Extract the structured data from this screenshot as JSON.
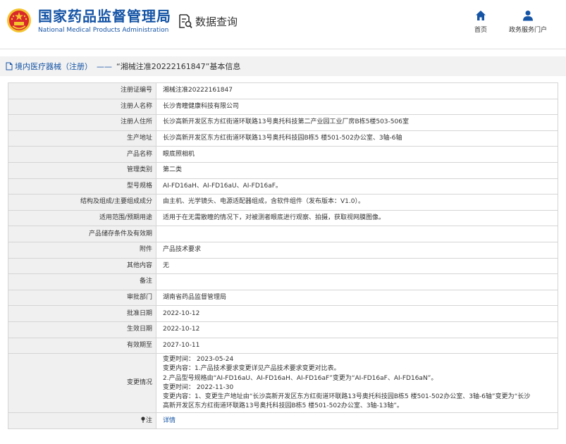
{
  "header": {
    "title_cn": "国家药品监督管理局",
    "title_en": "National Medical Products Administration",
    "query_label": "数据查询",
    "nav": [
      {
        "label": "首页",
        "icon": "home-icon"
      },
      {
        "label": "政务服务门户",
        "icon": "user-icon"
      }
    ]
  },
  "breadcrumb": {
    "section": "境内医疗器械（注册）",
    "separator": "——",
    "current": "“湘械注准20222161847”基本信息"
  },
  "details": {
    "rows": [
      {
        "label": "注册证编号",
        "value": "湘械注准20222161847"
      },
      {
        "label": "注册人名称",
        "value": "长沙青瞳健康科技有限公司"
      },
      {
        "label": "注册人住所",
        "value": "长沙高新开发区东方红街道环联路13号奥托科技第二产业园工业厂房B栋5楼503-506室"
      },
      {
        "label": "生产地址",
        "value": "长沙高新开发区东方红街道环联路13号奥托科技园B栋5 楼501-502办公室、3轴-6轴"
      },
      {
        "label": "产品名称",
        "value": "眼底照相机"
      },
      {
        "label": "管理类别",
        "value": "第二类"
      },
      {
        "label": "型号规格",
        "value": "AI-FD16aH、AI-FD16aU、AI-FD16aF。"
      },
      {
        "label": "结构及组成/主要组成成分",
        "value": "由主机、光学镜头、电源适配器组成，含软件组件（发布版本：V1.0）。"
      },
      {
        "label": "适用范围/预期用途",
        "value": "适用于在无需散瞳的情况下，对被测者眼底进行观察、拍摄，获取视网膜图像。"
      },
      {
        "label": "产品储存条件及有效期",
        "value": ""
      },
      {
        "label": "附件",
        "value": "产品技术要求"
      },
      {
        "label": "其他内容",
        "value": "无"
      },
      {
        "label": "备注",
        "value": ""
      },
      {
        "label": "审批部门",
        "value": "湖南省药品监督管理局"
      },
      {
        "label": "批准日期",
        "value": "2022-10-12"
      },
      {
        "label": "生效日期",
        "value": "2022-10-12"
      },
      {
        "label": "有效期至",
        "value": "2027-10-11"
      }
    ],
    "changes": {
      "label": "变更情况",
      "lines": [
        "变更时间：  2023-05-24",
        "变更内容：1.产品技术要求变更详见产品技术要求变更对比表。",
        "2.产品型号规格由“AI-FD16aU、AI-FD16aH、AI-FD16aF”变更为“AI-FD16aF、AI-FD16aN”。",
        "变更时间：  2022-11-30",
        "变更内容：1、变更生产地址由“长沙高新开发区东方红街道环联路13号奥托科技园B栋5 楼501-502办公室、3轴-6轴”变更为“长沙",
        "高新开发区东方红街道环联路13号奥托科技园B栋5 楼501-502办公室、3轴-13轴”。"
      ]
    },
    "note": {
      "label": "注",
      "value": "详情"
    }
  },
  "colors": {
    "brand_blue": "#1554a5",
    "emblem_red": "#d8282b",
    "emblem_gold": "#f4c430"
  }
}
